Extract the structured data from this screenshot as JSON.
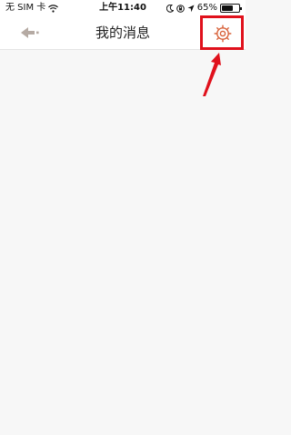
{
  "status_bar": {
    "carrier": "无 SIM 卡",
    "time": "上午11:40",
    "battery_percent": "65%",
    "battery_level": 0.65
  },
  "nav": {
    "title": "我的消息",
    "back_icon": "back-arrow-icon",
    "settings_icon": "gear-icon"
  },
  "annotation": {
    "highlight_color": "#e0111c"
  },
  "colors": {
    "icon_muted": "#b5aaa3",
    "gear": "#d8623a",
    "background": "#f7f7f7"
  }
}
